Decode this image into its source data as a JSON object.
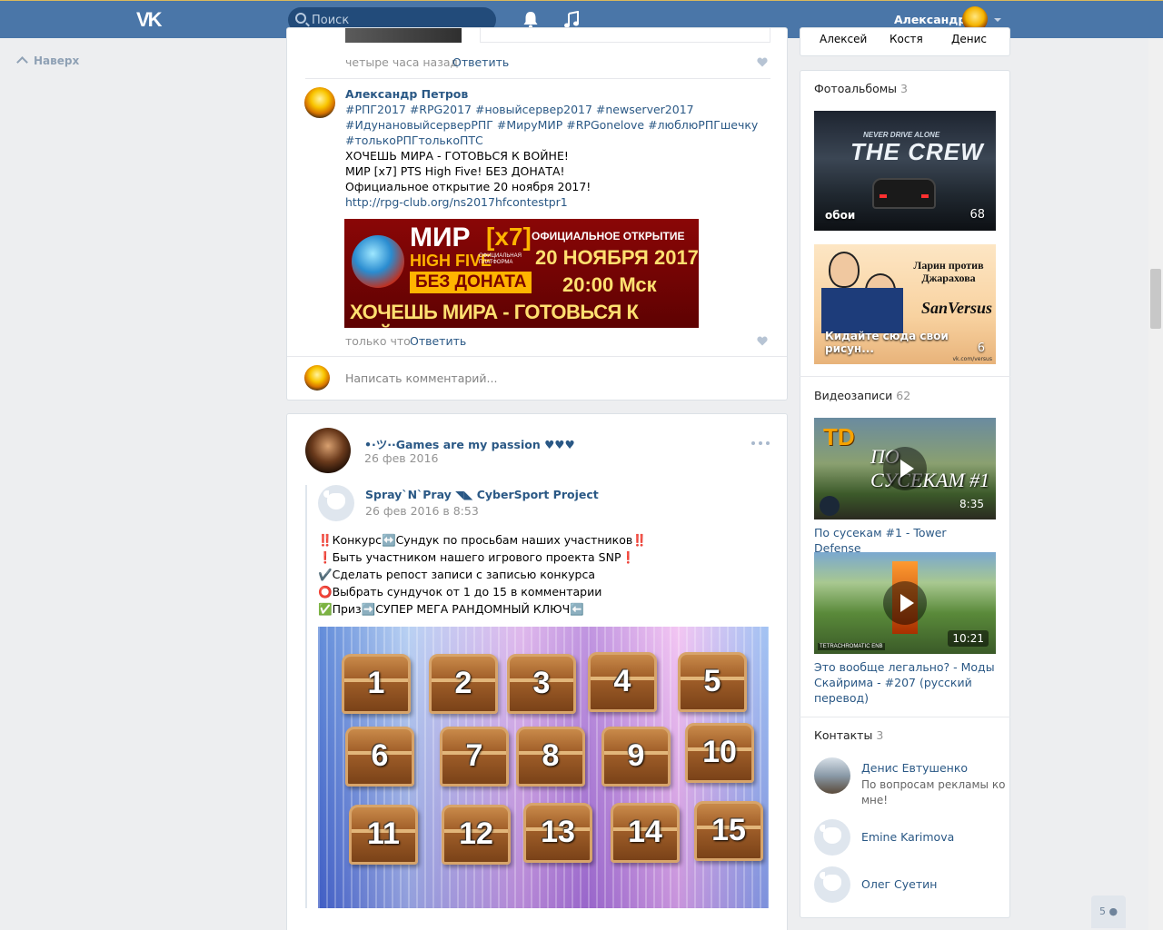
{
  "header": {
    "search_placeholder": "Поиск",
    "user_name": "Александр",
    "accent": "#4a76a8"
  },
  "left": {
    "back_to_top": "Наверх"
  },
  "top_post": {
    "time": "четыре часа назад",
    "reply": "Ответить"
  },
  "comment": {
    "author": "Александр Петров",
    "hashtags": [
      "#РПГ2017 #RPG2017 #новыйсервер2017 #newserver2017",
      "#ИдунановыйсерверРПГ #МируМИР #RPGonelove #люблюРПГшечку",
      "#толькоРПГтолькоПТС"
    ],
    "lines": [
      "ХОЧЕШЬ МИРА - ГОТОВЬСЯ К ВОЙНЕ!",
      "МИР [x7] PTS High Five! БЕЗ ДОНАТА!",
      "Официальное открытие 20 ноября 2017!"
    ],
    "link": "http://rpg-club.org/ns2017hfcontestpr1",
    "banner": {
      "mir": "МИР",
      "x7": "[x7]",
      "hf": "HIGH FIVE",
      "plat": "ОФИЦИАЛЬНАЯ ПЛАТФОРМА",
      "bez": "БЕЗ ДОНАТА",
      "off": "ОФИЦИАЛЬНОЕ ОТКРЫТИЕ",
      "date": "20 НОЯБРЯ 2017",
      "time": "20:00 Мск",
      "war": "ХОЧЕШЬ МИРА - ГОТОВЬСЯ К ВОЙНЕ"
    },
    "time": "только что",
    "reply": "Ответить",
    "write_placeholder": "Написать комментарий..."
  },
  "post2": {
    "author": "•·ツ··Games are my passion ♥♥♥",
    "date": "26 фев 2016",
    "repost_author": "Spray`N`Pray ◥◣ CyberSport Project",
    "repost_date": "26 фев 2016 в 8:53",
    "lines": [
      "‼️Конкурс↔️Сундук по просьбам наших участников‼️",
      "❗Быть участником нашего игрового проекта SNP❗",
      "✔️Сделать репост записи с записью конкурса",
      "⭕Выбрать сундучок от 1 до 15 в комментарии",
      "✅Приз➡️СУПЕР МЕГА РАНДОМНЫЙ КЛЮЧ⬅️"
    ],
    "chests": [
      "1",
      "2",
      "3",
      "4",
      "5",
      "6",
      "7",
      "8",
      "9",
      "10",
      "11",
      "12",
      "13",
      "14",
      "15"
    ]
  },
  "friends_row": [
    "Алексей",
    "Костя",
    "Денис"
  ],
  "albums": {
    "title": "Фотоальбомы",
    "count": "3",
    "items": [
      {
        "caption": "обои",
        "count": "68",
        "art": "THE CREW",
        "art_sub": "NEVER DRIVE ALONE"
      },
      {
        "caption": "Кидайте сюда свои рисун...",
        "count": "6",
        "art": "Ларин против Джарахова",
        "art_sub": "SanVersus",
        "watermark": "vk.com/versus"
      }
    ]
  },
  "videos": {
    "title": "Видеозаписи",
    "count": "62",
    "items": [
      {
        "title": "По сусекам #1 - Tower Defense",
        "duration": "8:35",
        "art": "ПО СУСЕКАМ #1",
        "badge": "TD"
      },
      {
        "title_lines": [
          "Это вообще легально? - Моды",
          "Скайрима - #207 (русский",
          "перевод)"
        ],
        "duration": "10:21",
        "badge": "TETRACHROMATIC ENB"
      }
    ]
  },
  "contacts": {
    "title": "Контакты",
    "count": "3",
    "items": [
      {
        "name": "Денис Евтушенко",
        "desc_lines": [
          "По вопросам рекламы ко",
          "мне!"
        ]
      },
      {
        "name": "Emine Karimova"
      },
      {
        "name": "Олег Суетин"
      }
    ]
  },
  "online_count": "5"
}
